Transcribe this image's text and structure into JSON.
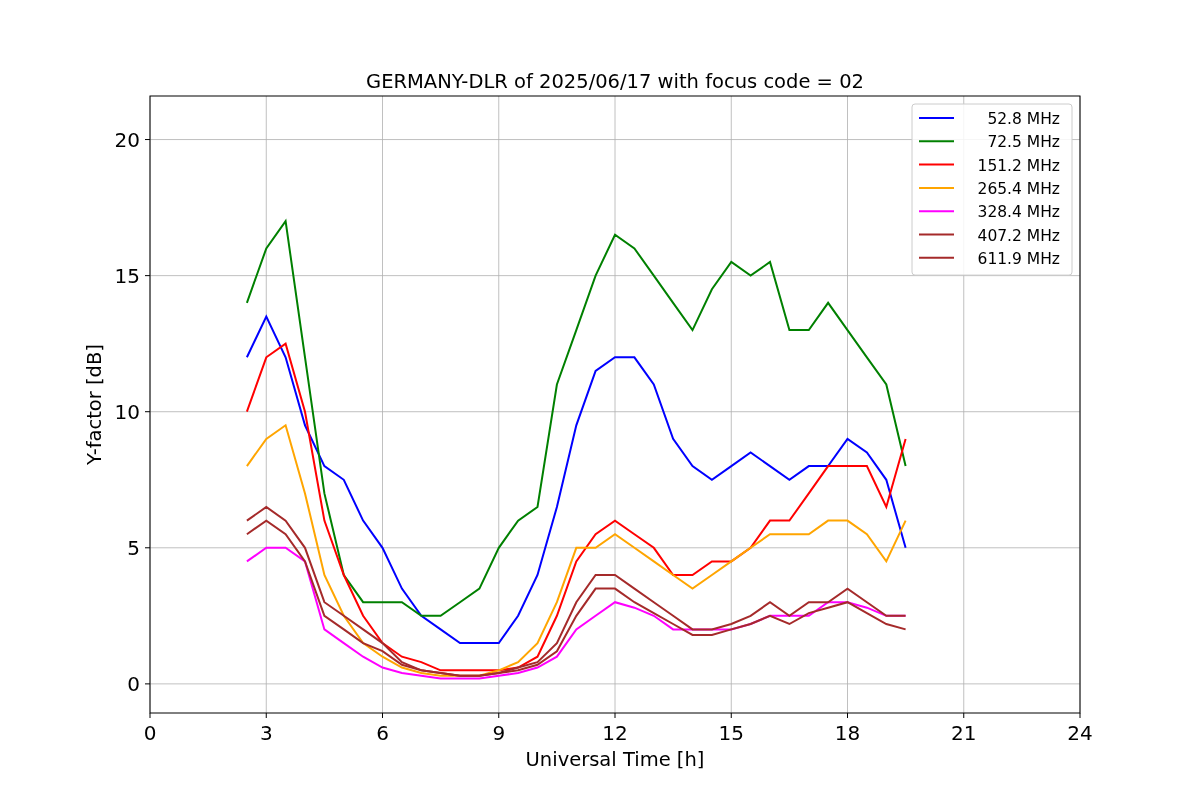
{
  "chart_data": {
    "type": "line",
    "title": "GERMANY-DLR of 2025/06/17 with focus code = 02",
    "xlabel": "Universal Time [h]",
    "ylabel": "Y-factor [dB]",
    "x": [
      2.5,
      3,
      3.5,
      4,
      4.5,
      5,
      5.5,
      6,
      6.5,
      7,
      7.5,
      8,
      8.5,
      9,
      9.5,
      10,
      10.5,
      11,
      11.5,
      12,
      12.5,
      13,
      13.5,
      14,
      14.5,
      15,
      15.5,
      16,
      16.5,
      17,
      17.5,
      18,
      18.5,
      19,
      19.5
    ],
    "series": [
      {
        "name": "52.8 MHz",
        "color": "#0000ff",
        "values": [
          12,
          13.5,
          12,
          9.5,
          8,
          7.5,
          6,
          5,
          3.5,
          2.5,
          2,
          1.5,
          1.5,
          1.5,
          2.5,
          4,
          6.5,
          9.5,
          11.5,
          12,
          12,
          11,
          9,
          8,
          7.5,
          8,
          8.5,
          8,
          7.5,
          8,
          8,
          9,
          8.5,
          7.5,
          5
        ]
      },
      {
        "name": "72.5 MHz",
        "color": "#008000",
        "values": [
          14,
          16,
          17,
          12,
          7,
          4,
          3,
          3,
          3,
          2.5,
          2.5,
          3,
          3.5,
          5,
          6,
          6.5,
          11,
          13,
          15,
          16.5,
          16,
          15,
          14,
          13,
          14.5,
          15.5,
          15,
          15.5,
          13,
          13,
          14,
          13,
          12,
          11,
          8
        ]
      },
      {
        "name": "151.2 MHz",
        "color": "#ff0000",
        "values": [
          10,
          12,
          12.5,
          10,
          6,
          4,
          2.5,
          1.5,
          1,
          0.8,
          0.5,
          0.5,
          0.5,
          0.5,
          0.6,
          1,
          2.5,
          4.5,
          5.5,
          6,
          5.5,
          5,
          4,
          4,
          4.5,
          4.5,
          5,
          6,
          6,
          7,
          8,
          8,
          8,
          6.5,
          9
        ]
      },
      {
        "name": "265.4 MHz",
        "color": "#ffa500",
        "values": [
          8,
          9,
          9.5,
          7,
          4,
          2.5,
          1.5,
          1,
          0.6,
          0.4,
          0.3,
          0.3,
          0.3,
          0.5,
          0.8,
          1.5,
          3,
          5,
          5,
          5.5,
          5,
          4.5,
          4,
          3.5,
          4,
          4.5,
          5,
          5.5,
          5.5,
          5.5,
          6,
          6,
          5.5,
          4.5,
          6
        ]
      },
      {
        "name": "328.4 MHz",
        "color": "#ff00ff",
        "values": [
          4.5,
          5,
          5,
          4.5,
          2,
          1.5,
          1,
          0.6,
          0.4,
          0.3,
          0.2,
          0.2,
          0.2,
          0.3,
          0.4,
          0.6,
          1,
          2,
          2.5,
          3,
          2.8,
          2.5,
          2,
          2,
          2,
          2,
          2.2,
          2.5,
          2.5,
          2.5,
          3,
          3,
          2.8,
          2.5,
          2.5
        ]
      },
      {
        "name": "407.2 MHz",
        "color": "#a52a2a",
        "values": [
          6,
          6.5,
          6,
          5,
          3,
          2.5,
          2,
          1.5,
          0.8,
          0.5,
          0.4,
          0.3,
          0.3,
          0.4,
          0.6,
          0.8,
          1.5,
          3,
          4,
          4,
          3.5,
          3,
          2.5,
          2,
          2,
          2.2,
          2.5,
          3,
          2.5,
          3,
          3,
          3.5,
          3,
          2.5,
          2.5
        ]
      },
      {
        "name": "611.9 MHz",
        "color": "#a52a2a",
        "values": [
          5.5,
          6,
          5.5,
          4.5,
          2.5,
          2,
          1.5,
          1.2,
          0.7,
          0.5,
          0.4,
          0.3,
          0.3,
          0.4,
          0.5,
          0.7,
          1.2,
          2.5,
          3.5,
          3.5,
          3,
          2.6,
          2.2,
          1.8,
          1.8,
          2,
          2.2,
          2.5,
          2.2,
          2.6,
          2.8,
          3,
          2.6,
          2.2,
          2
        ]
      }
    ],
    "grid": true,
    "legend": true,
    "xlim": [
      0,
      24
    ],
    "ylim": [
      -1.07,
      21.6
    ],
    "xticks": [
      0,
      3,
      6,
      9,
      12,
      15,
      18,
      21,
      24
    ],
    "yticks": [
      0,
      5,
      10,
      15,
      20
    ]
  }
}
